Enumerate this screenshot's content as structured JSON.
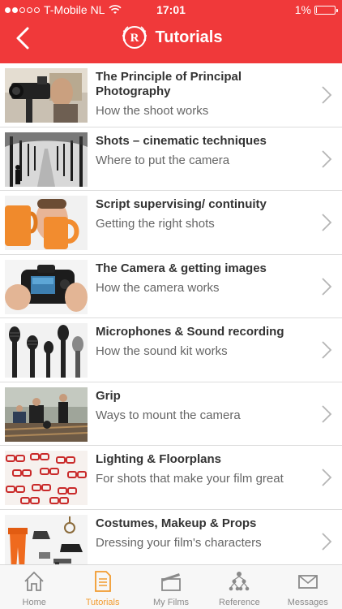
{
  "status_bar": {
    "carrier": "T-Mobile NL",
    "time": "17:01",
    "battery": "1%",
    "battery_level": 0.01
  },
  "header": {
    "title": "Tutorials"
  },
  "tutorials": [
    {
      "title": "The Principle of Principal Photography",
      "subtitle": "How the shoot works",
      "thumb": "film-camera-crew"
    },
    {
      "title": "Shots – cinematic techniques",
      "subtitle": "Where to put the camera",
      "thumb": "tree-lined-road"
    },
    {
      "title": "Script supervising/ continuity",
      "subtitle": "Getting the right shots",
      "thumb": "man-with-mugs"
    },
    {
      "title": "The Camera & getting images",
      "subtitle": "How the camera works",
      "thumb": "camera-in-hands"
    },
    {
      "title": "Microphones & Sound recording",
      "subtitle": "How the sound kit works",
      "thumb": "microphones"
    },
    {
      "title": "Grip",
      "subtitle": "Ways to mount the camera",
      "thumb": "camera-dolly"
    },
    {
      "title": "Lighting & Floorplans",
      "subtitle": "For shots that make your film great",
      "thumb": "red-glasses-pattern"
    },
    {
      "title": "Costumes, Makeup & Props",
      "subtitle": "Dressing your film's characters",
      "thumb": "costume-props"
    }
  ],
  "tab_bar": {
    "tabs": [
      {
        "label": "Home",
        "icon": "home-icon"
      },
      {
        "label": "Tutorials",
        "icon": "document-icon",
        "active": true
      },
      {
        "label": "My Films",
        "icon": "clapperboard-icon"
      },
      {
        "label": "Reference",
        "icon": "hierarchy-icon"
      },
      {
        "label": "Messages",
        "icon": "envelope-icon"
      }
    ]
  },
  "colors": {
    "header": "#f0393a",
    "active_tab": "#f29b2f",
    "inactive_tab": "#8a8a8a"
  }
}
